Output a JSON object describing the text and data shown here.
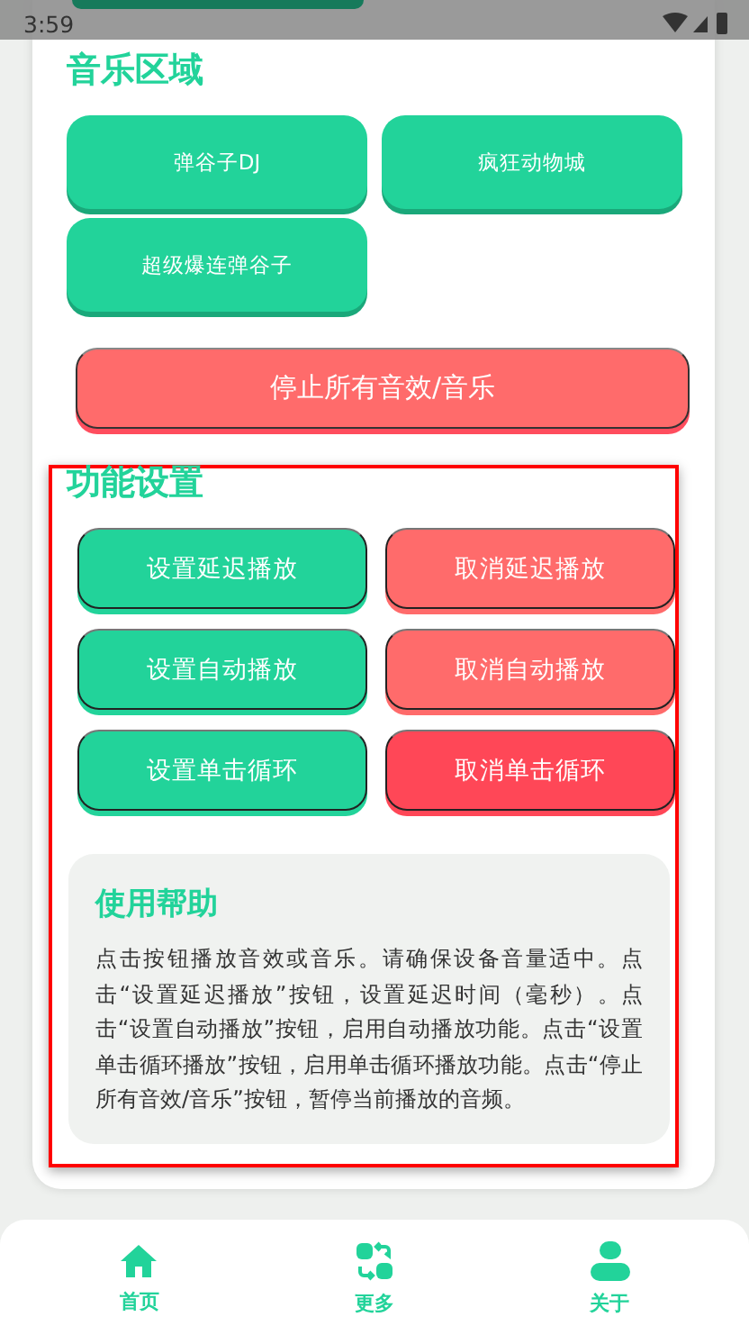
{
  "status_bar": {
    "time": "3:59"
  },
  "music": {
    "title": "音乐区域",
    "buttons": [
      {
        "label": "弹谷子DJ"
      },
      {
        "label": "疯狂动物城"
      },
      {
        "label": "超级爆连弹谷子"
      }
    ],
    "stop_button": "停止所有音效/音乐"
  },
  "settings": {
    "title": "功能设置",
    "buttons": [
      {
        "label": "设置延迟播放",
        "color": "#22d39a"
      },
      {
        "label": "取消延迟播放",
        "color": "#ff6b6b"
      },
      {
        "label": "设置自动播放",
        "color": "#22d39a"
      },
      {
        "label": "取消自动播放",
        "color": "#ff6b6b"
      },
      {
        "label": "设置单击循环",
        "color": "#22d39a"
      },
      {
        "label": "取消单击循环",
        "color": "#ff4757"
      }
    ]
  },
  "help": {
    "title": "使用帮助",
    "text": "点击按钮播放音效或音乐。请确保设备音量适中。点击“设置延迟播放”按钮，设置延迟时间（毫秒）。点击“设置自动播放”按钮，启用自动播放功能。点击“设置单击循环播放”按钮，启用单击循环播放功能。点击“停止所有音效/音乐”按钮，暂停当前播放的音频。"
  },
  "bottom_nav": [
    {
      "kind": "home",
      "label": "首页"
    },
    {
      "kind": "more",
      "label": "更多"
    },
    {
      "kind": "person",
      "label": "关于"
    }
  ]
}
